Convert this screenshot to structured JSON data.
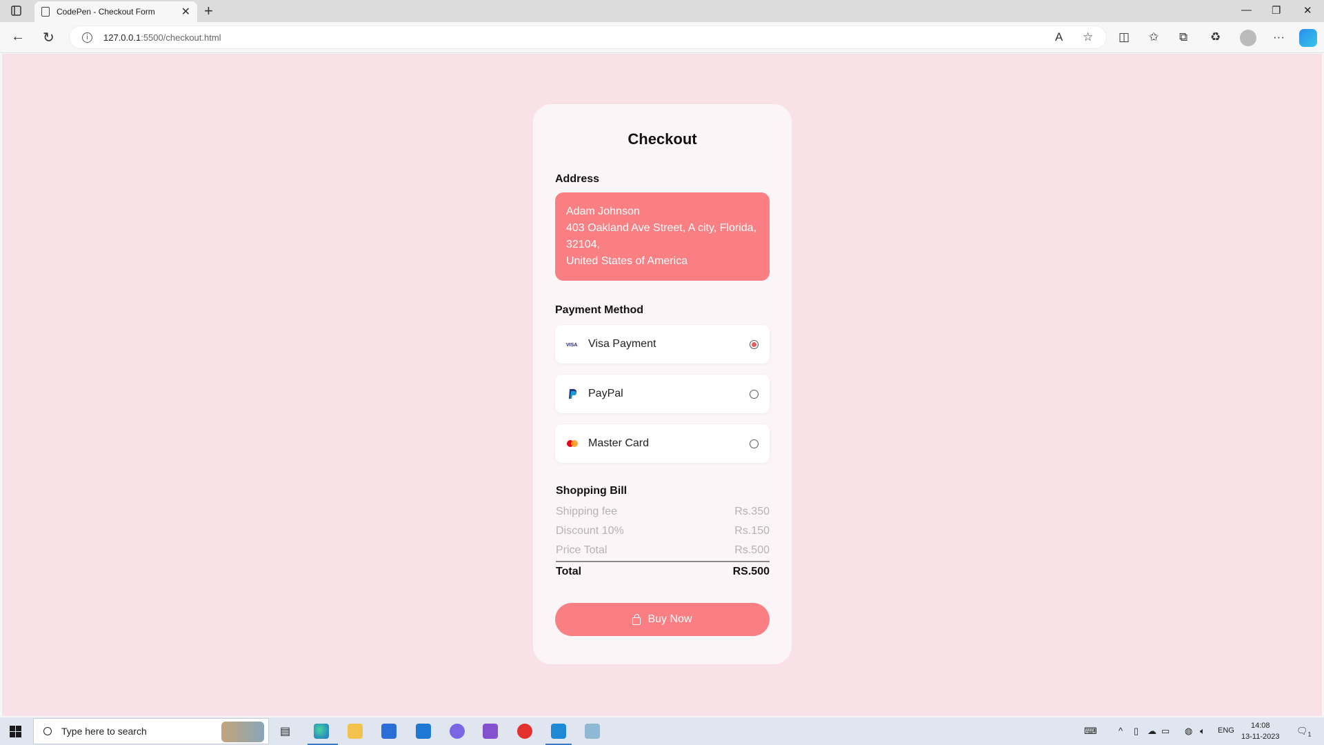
{
  "browser": {
    "tab_title": "CodePen - Checkout Form",
    "url_host": "127.0.0.1",
    "url_path": ":5500/checkout.html"
  },
  "checkout": {
    "title": "Checkout",
    "address_heading": "Address",
    "address": {
      "name": "Adam Johnson",
      "line1": "403 Oakland Ave Street, A city, Florida,",
      "line2": "32104,",
      "country": "United States of America"
    },
    "payment_heading": "Payment Method",
    "payment_methods": [
      {
        "label": "Visa Payment",
        "selected": true,
        "logo": "visa-icon"
      },
      {
        "label": "PayPal",
        "selected": false,
        "logo": "paypal-icon"
      },
      {
        "label": "Master Card",
        "selected": false,
        "logo": "mastercard-icon"
      }
    ],
    "bill_heading": "Shopping Bill",
    "bill_rows": [
      {
        "label": "Shipping fee",
        "value": "Rs.350"
      },
      {
        "label": "Discount 10%",
        "value": "Rs.150"
      },
      {
        "label": "Price Total",
        "value": "Rs.500"
      }
    ],
    "total": {
      "label": "Total",
      "value": "RS.500"
    },
    "buy_label": "Buy Now"
  },
  "taskbar": {
    "search_placeholder": "Type here to search",
    "language": "ENG",
    "time": "14:08",
    "date": "13-11-2023",
    "notification_count": "1"
  },
  "colors": {
    "accent": "#fa7f83",
    "page_bg": "#f9e1e8",
    "card_bg": "#fbf5f7"
  }
}
